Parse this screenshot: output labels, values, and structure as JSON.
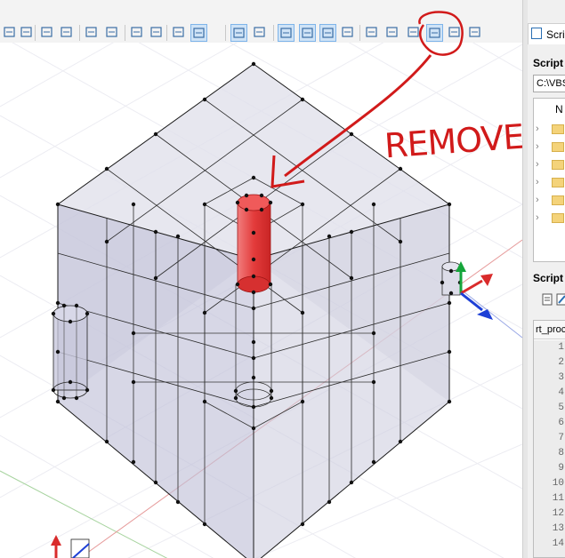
{
  "toolbar": {
    "buttons": [
      {
        "name": "eye-icon",
        "active": false
      },
      {
        "name": "eye-hide-icon",
        "active": false
      },
      {
        "name": "road-icon",
        "active": false
      },
      {
        "name": "columns-icon",
        "active": false
      },
      {
        "name": "zoom-extents-icon",
        "active": false
      },
      {
        "name": "zoom-icon",
        "active": false
      },
      {
        "name": "monitor-icon",
        "active": false
      },
      {
        "name": "paint-icon",
        "active": false
      },
      {
        "name": "grid-dots-icon",
        "active": false
      },
      {
        "name": "grid-active-icon",
        "active": true
      },
      {
        "name": "select-box-icon",
        "active": true
      },
      {
        "name": "select-check-icon",
        "active": false
      },
      {
        "name": "view-people-icon",
        "active": true
      },
      {
        "name": "view-arch-icon",
        "active": true
      },
      {
        "name": "view-bridge-icon",
        "active": true
      },
      {
        "name": "tool-cut-icon",
        "active": false
      },
      {
        "name": "layer-a-icon",
        "active": false
      },
      {
        "name": "layer-b-icon",
        "active": false
      },
      {
        "name": "layer-c-icon",
        "active": false
      },
      {
        "name": "layer-d-icon",
        "active": true
      },
      {
        "name": "layer-e-icon",
        "active": false
      },
      {
        "name": "layer-f-icon",
        "active": false
      }
    ],
    "accent": "#7eb4ea"
  },
  "annotation": {
    "text": "REMOVE",
    "color": "#d11a1a"
  },
  "panel": {
    "tab_label": "Script",
    "section_label": "Script",
    "path_value": "C:\\VBS",
    "tree_header": "N",
    "tree_rows": 6,
    "section2_label": "Script",
    "code_tab": "rt_proc",
    "line_numbers": [
      "1",
      "2",
      "3",
      "4",
      "5",
      "6",
      "7",
      "8",
      "9",
      "10",
      "11",
      "12",
      "13",
      "14"
    ]
  },
  "scene": {
    "highlight_color": "#e8403f",
    "mesh_color": "#c9c9df"
  }
}
